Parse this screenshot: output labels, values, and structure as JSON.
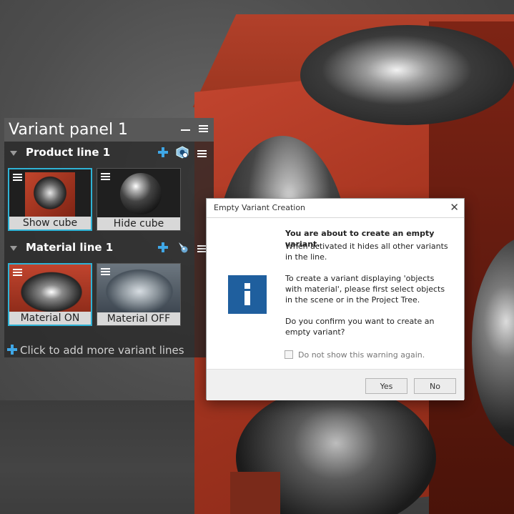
{
  "panel": {
    "title": "Variant panel 1",
    "lines": [
      {
        "title": "Product line 1",
        "variants": [
          {
            "label": "Show cube",
            "selected": true
          },
          {
            "label": "Hide cube",
            "selected": false
          }
        ]
      },
      {
        "title": "Material line 1",
        "variants": [
          {
            "label": "Material ON",
            "selected": true
          },
          {
            "label": "Material OFF",
            "selected": false
          }
        ]
      }
    ],
    "add_lines_label": "Click to add more variant lines"
  },
  "dialog": {
    "title": "Empty Variant Creation",
    "heading": "You are about to create an empty variant.",
    "para1": "When activated it hides all other variants in the line.",
    "para2": "To create a variant displaying 'objects with material', please first select objects in the scene or in the Project Tree.",
    "para3": "Do you confirm you want to create an empty variant?",
    "checkbox_label": "Do not show this warning again.",
    "checkbox_checked": false,
    "yes_label": "Yes",
    "no_label": "No",
    "close_glyph": "✕"
  },
  "colors": {
    "accent": "#3fa7e6",
    "selection": "#2fb3d6",
    "info_icon": "#1f5f9e",
    "cube": "#b03a24"
  }
}
